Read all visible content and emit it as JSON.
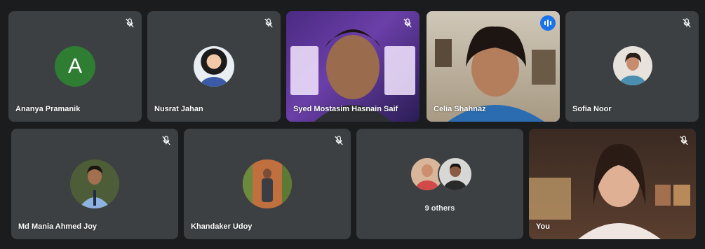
{
  "meeting": {
    "participants": [
      {
        "name": "Ananya Pramanik",
        "avatar_letter": "A",
        "avatar_color": "#2e7d32",
        "mic": "muted"
      },
      {
        "name": "Nusrat Jahan",
        "mic": "muted"
      },
      {
        "name": "Syed Mostasim Hasnain Saif",
        "mic": "muted"
      },
      {
        "name": "Celia Shahnaz",
        "mic": "speaking"
      },
      {
        "name": "Sofia Noor",
        "mic": "muted"
      },
      {
        "name": "Md Mania Ahmed Joy",
        "mic": "muted"
      },
      {
        "name": "Khandaker Udoy",
        "mic": "muted"
      },
      {
        "name": "You",
        "mic": "muted"
      }
    ],
    "others": {
      "label": "9 others"
    }
  },
  "colors": {
    "tile_bg": "#3c4043",
    "page_bg": "#1b1c1e",
    "active_border": "#8ab4f8",
    "speaking_badge": "#1a73e8"
  },
  "icons": {
    "mic_off": "mic-off-icon",
    "speaking": "audio-level-icon"
  }
}
